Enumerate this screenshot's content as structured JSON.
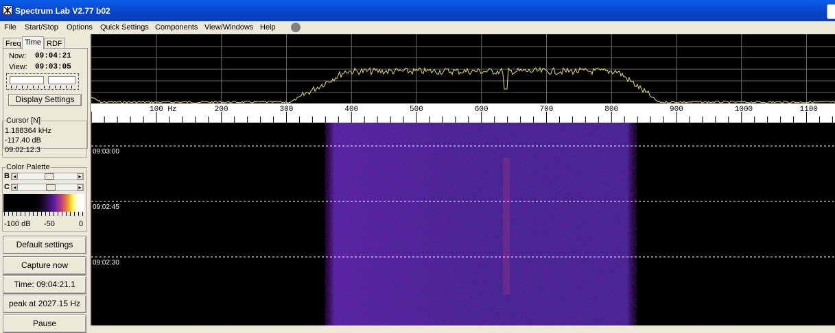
{
  "window": {
    "title": "Spectrum Lab V2.77 b02"
  },
  "menu": [
    "File",
    "Start/Stop",
    "Options",
    "Quick Settings",
    "Components",
    "View/Windows",
    "Help"
  ],
  "tabs": [
    "Freq",
    "Time",
    "RDF"
  ],
  "time_panel": {
    "now_label": "Now:",
    "now_value": "09:04:21",
    "view_label": "View:",
    "view_value": "09:03:05",
    "display_settings": "Display Settings"
  },
  "cursor": {
    "caption": "Cursor [N]",
    "freq": "1.188364 kHz",
    "level": "-117.40 dB",
    "time": "09:02:12.3"
  },
  "color_palette": {
    "caption": "Color Palette",
    "b_label": "B",
    "c_label": "C",
    "scale": [
      "-100 dB",
      "-50",
      "0"
    ]
  },
  "buttons": {
    "default_settings": "Default settings",
    "capture_now": "Capture now",
    "time_display": "Time:  09:04:21.1",
    "peak": "peak at 2027.15 Hz",
    "pause": "Pause"
  },
  "spectrum": {
    "freq_labels": [
      "100 Hz",
      "200",
      "300",
      "400",
      "500",
      "600",
      "700",
      "800",
      "900",
      "1000",
      "1100"
    ],
    "freq_values": [
      100,
      200,
      300,
      400,
      500,
      600,
      700,
      800,
      900,
      1000,
      1100
    ],
    "trace_color": "#e8e070",
    "grid_color": "#6a6a6a",
    "band_start_hz": 370,
    "band_end_hz": 830
  },
  "waterfall": {
    "time_marks": [
      "09:03:00",
      "09:02:45",
      "09:02:30"
    ],
    "band_color": "#4a2a9a"
  }
}
